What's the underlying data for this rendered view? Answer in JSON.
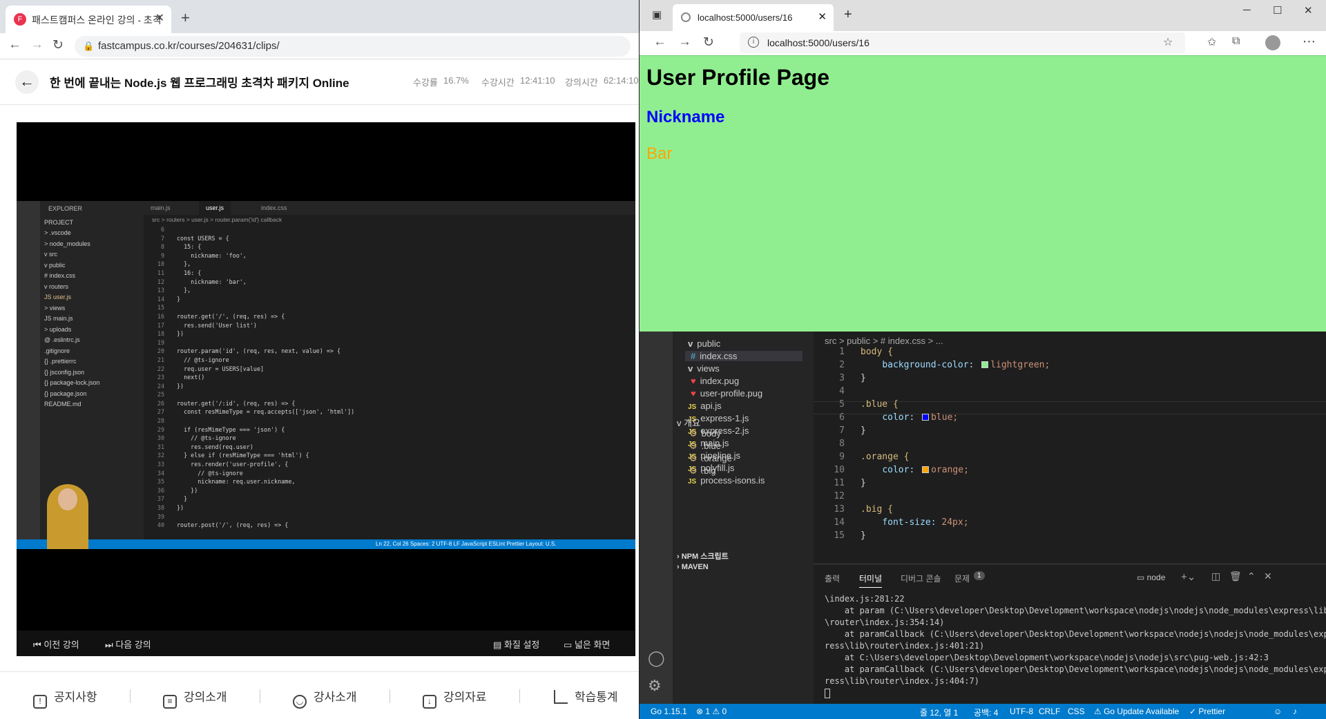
{
  "left_browser": {
    "tab_title": "패스트캠퍼스 온라인 강의 - 초격",
    "url": "fastcampus.co.kr/courses/204631/clips/",
    "course_title": "한 번에 끝내는 Node.js 웹 프로그래밍 초격차 패키지 Online",
    "progress_label": "수강률",
    "progress_value": "16.7%",
    "watch_label": "수강시간",
    "watch_value": "12:41:10",
    "lecture_label": "강의시간",
    "lecture_value": "62:14:10",
    "player": {
      "prev": "이전 강의",
      "next": "다음 강의",
      "quality": "화질 설정",
      "wide": "넓은 화면"
    },
    "footer_tabs": [
      "공지사항",
      "강의소개",
      "강사소개",
      "강의자료",
      "학습통계"
    ]
  },
  "video_vscode": {
    "explorer_label": "EXPLORER",
    "tabs": [
      "main.js",
      "user.js",
      "index.css"
    ],
    "breadcrumb": "src > routers > user.js > router.param('id') callback",
    "tree": [
      "PROJECT",
      "> .vscode",
      "> node_modules",
      "v src",
      "  v public",
      "    # index.css",
      "  v routers",
      "    JS user.js",
      "  > views",
      "  JS main.js",
      "> uploads",
      "@ .eslintrc.js",
      "  .gitignore",
      "{} .prettierrc",
      "{} jsconfig.json",
      "{} package-lock.json",
      "{} package.json",
      "  README.md"
    ],
    "line_numbers": "6\n7\n8\n9\n10\n11\n12\n13\n14\n15\n16\n17\n18\n19\n20\n21\n22\n23\n24\n25\n26\n27\n28\n29\n30\n31\n32\n33\n34\n35\n36\n37\n38\n39\n40",
    "code": "\nconst USERS = {\n  15: {\n    nickname: 'foo',\n  },\n  16: {\n    nickname: 'bar',\n  },\n}\n\nrouter.get('/', (req, res) => {\n  res.send('User list')\n})\n\nrouter.param('id', (req, res, next, value) => {\n  // @ts-ignore\n  req.user = USERS[value]\n  next()\n})\n\nrouter.get('/:id', (req, res) => {\n  const resMimeType = req.accepts(['json', 'html'])\n\n  if (resMimeType === 'json') {\n    // @ts-ignore\n    res.send(req.user)\n  } else if (resMimeType === 'html') {\n    res.render('user-profile', {\n      // @ts-ignore\n      nickname: req.user.nickname,\n    })\n  }\n})\n\nrouter.post('/', (req, res) => {",
    "status": "Ln 22, Col 26   Spaces: 2   UTF-8   LF   JavaScript   ESLint   Prettier   Layout: U.S."
  },
  "right_browser": {
    "tab_title": "localhost:5000/users/16",
    "url": "localhost:5000/users/16",
    "h1": "User Profile Page",
    "h2": "Nickname",
    "nickname_value": "Bar",
    "bg_color": "#90ee90"
  },
  "editor": {
    "breadcrumb": "src > public > # index.css > ...",
    "tree": [
      {
        "label": "public",
        "kind": "folder-open"
      },
      {
        "label": "index.css",
        "kind": "css"
      },
      {
        "label": "views",
        "kind": "folder-open"
      },
      {
        "label": "index.pug",
        "kind": "pug"
      },
      {
        "label": "user-profile.pug",
        "kind": "pug"
      },
      {
        "label": "api.js",
        "kind": "js"
      },
      {
        "label": "express-1.js",
        "kind": "js"
      },
      {
        "label": "express-2.js",
        "kind": "js"
      },
      {
        "label": "main.js",
        "kind": "js"
      },
      {
        "label": "pipeline.js",
        "kind": "js"
      },
      {
        "label": "polyfill.js",
        "kind": "js"
      },
      {
        "label": "process-isons.is",
        "kind": "js"
      }
    ],
    "outline_label": "개요",
    "outline": [
      "body",
      ".blue",
      ".orange",
      ".big"
    ],
    "npm_label": "NPM 스크립트",
    "maven_label": "MAVEN",
    "line_numbers": "1\n2\n3\n4\n5\n6\n7\n8\n9\n10\n11\n12\n13\n14\n15",
    "code_lines": [
      "body {",
      "  background-color: lightgreen;",
      "}",
      "",
      ".blue {",
      "  color: blue;",
      "}",
      "",
      ".orange {",
      "  color: orange;",
      "}",
      "",
      ".big {",
      "  font-size: 24px;",
      "}"
    ],
    "panel_tabs": [
      "출력",
      "터미널",
      "디버그 콘솔",
      "문제"
    ],
    "problem_count": "1",
    "terminal_name": "node",
    "terminal": "\\index.js:281:22\n    at param (C:\\Users\\developer\\Desktop\\Development\\workspace\\nodejs\\nodejs\\node_modules\\express\\lib\n\\router\\index.js:354:14)\n    at paramCallback (C:\\Users\\developer\\Desktop\\Development\\workspace\\nodejs\\nodejs\\node_modules\\exp\nress\\lib\\router\\index.js:401:21)\n    at C:\\Users\\developer\\Desktop\\Development\\workspace\\nodejs\\nodejs\\src\\pug-web.js:42:3\n    at paramCallback (C:\\Users\\developer\\Desktop\\Development\\workspace\\nodejs\\nodejs\\node_modules\\exp\nress\\lib\\router\\index.js:404:7)",
    "status": {
      "go": "Go 1.15.1",
      "errors": "⊗ 1 ⚠ 0",
      "position": "줄 12, 열 1",
      "spaces": "공백: 4",
      "encoding": "UTF-8",
      "eol": "CRLF",
      "lang": "CSS",
      "update": "⚠ Go Update Available",
      "prettier": "✓ Prettier"
    }
  }
}
